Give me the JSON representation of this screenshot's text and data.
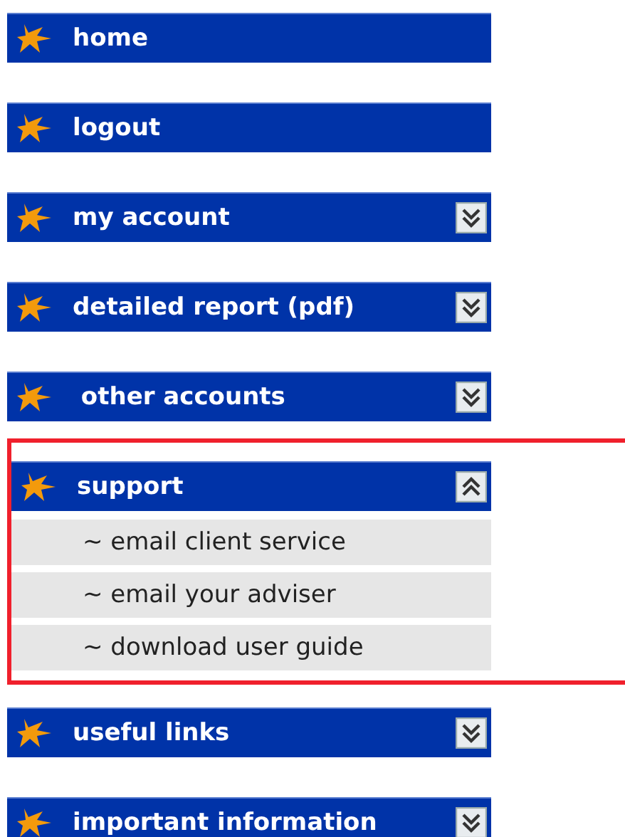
{
  "menu": [
    {
      "label": "home",
      "kind": "link",
      "highlighted": false
    },
    {
      "label": "logout",
      "kind": "link",
      "highlighted": false
    },
    {
      "label": "my account",
      "kind": "section",
      "expanded": false,
      "highlighted": false
    },
    {
      "label": "detailed report (pdf)",
      "kind": "section",
      "expanded": false,
      "highlighted": false
    },
    {
      "label": " other accounts",
      "kind": "section",
      "expanded": false,
      "highlighted": false
    },
    {
      "label": "support",
      "kind": "section",
      "expanded": true,
      "highlighted": true,
      "children": [
        {
          "label": "~ email client service"
        },
        {
          "label": "~ email your adviser"
        },
        {
          "label": "~ download user guide"
        }
      ]
    },
    {
      "label": "useful links",
      "kind": "section",
      "expanded": false,
      "highlighted": false
    },
    {
      "label": "important information",
      "kind": "section",
      "expanded": false,
      "highlighted": false
    }
  ]
}
